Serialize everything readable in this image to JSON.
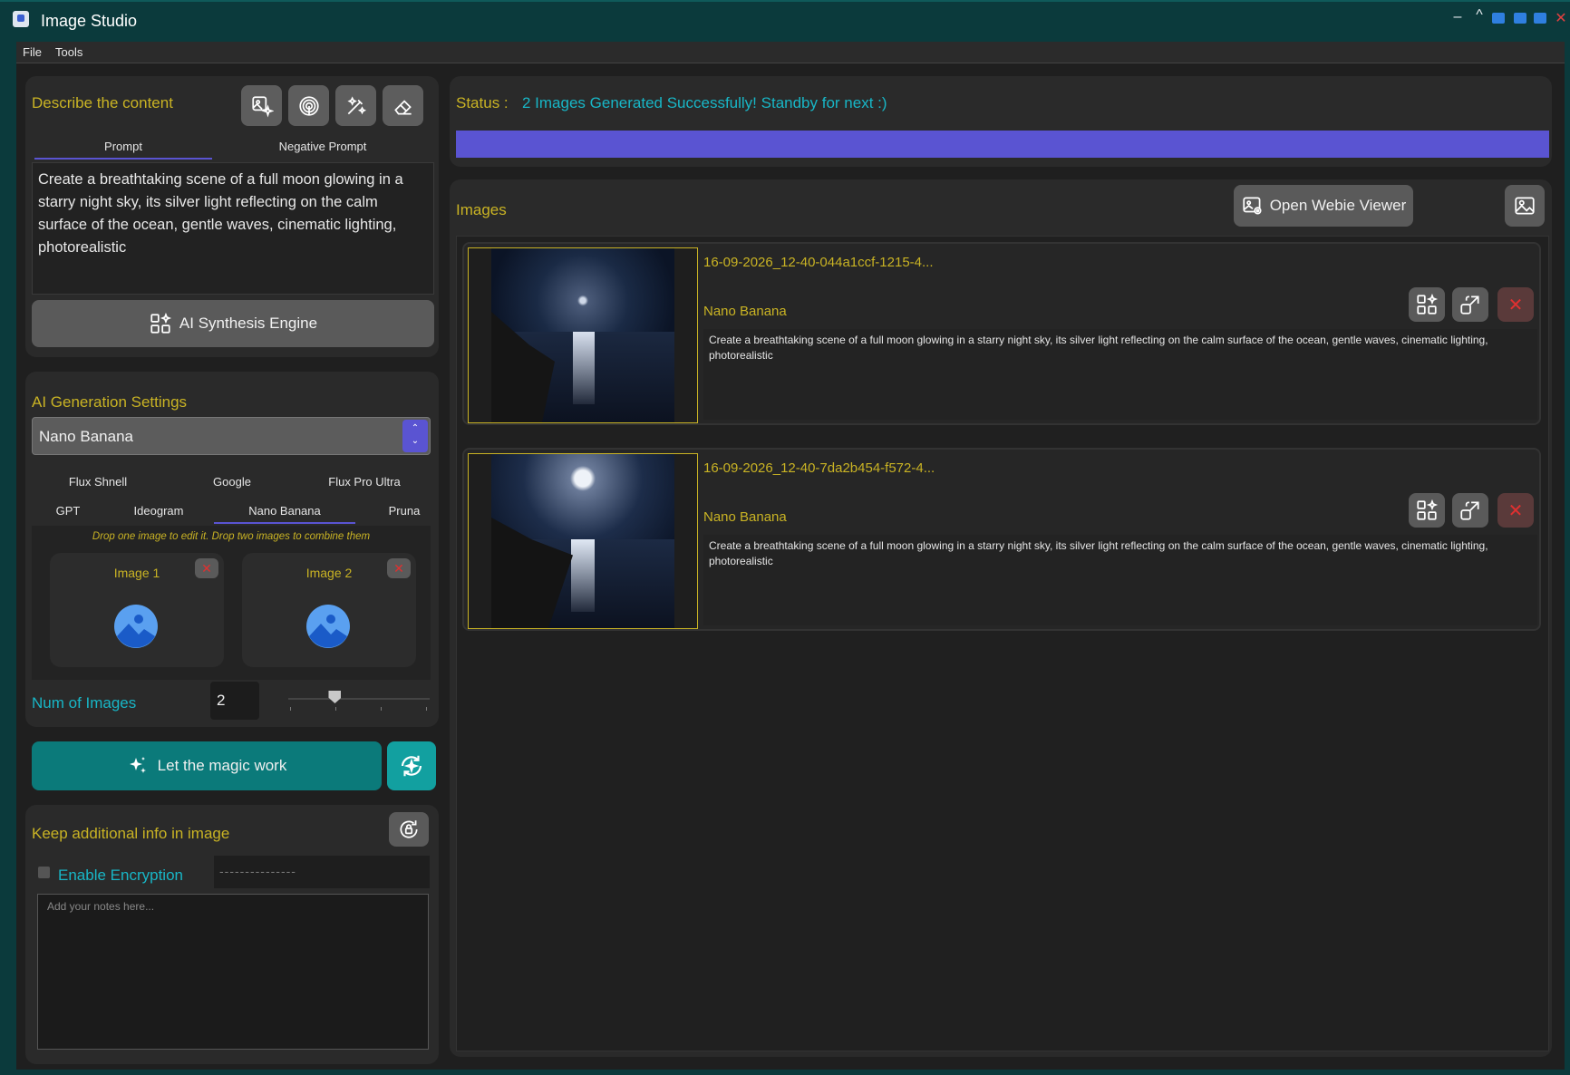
{
  "window": {
    "title": "Image Studio"
  },
  "menu": {
    "file": "File",
    "tools": "Tools"
  },
  "prompt_panel": {
    "heading": "Describe the content",
    "tabs": [
      "Prompt",
      "Negative Prompt"
    ],
    "prompt_text": "Create a breathtaking scene of a full moon glowing in a starry night sky, its silver light reflecting on the calm surface of the ocean, gentle waves, cinematic lighting, photorealistic",
    "engine_button": "AI Synthesis Engine"
  },
  "settings": {
    "heading": "AI Generation Settings",
    "model_selected": "Nano Banana",
    "model_tabs_row1": [
      "Flux Shnell",
      "Google",
      "Flux Pro Ultra"
    ],
    "model_tabs_row2": [
      "GPT",
      "Ideogram",
      "Nano Banana",
      "Pruna"
    ],
    "drop_hint": "Drop one image to edit it. Drop two images to combine them",
    "image1_label": "Image 1",
    "image2_label": "Image 2",
    "num_images_label": "Num of Images",
    "num_images_value": "2",
    "num_images_slider_fraction": 0.33
  },
  "magic_button": "Let the magic work",
  "notes": {
    "heading": "Keep additional info in image",
    "encryption_label": "Enable Encryption",
    "password_mask": "---------------",
    "notes_placeholder": "Add your notes here..."
  },
  "status": {
    "label": "Status :",
    "text": "2 Images Generated Successfully! Standby for next :)",
    "progress_fraction": 1.0,
    "progress_color": "#5a54d2"
  },
  "images_panel": {
    "heading": "Images",
    "webie_button": "Open Webie Viewer",
    "items": [
      {
        "filename": "16-09-2026_12-40-044a1ccf-1215-4...",
        "model": "Nano Banana",
        "prompt": "Create a breathtaking scene of a full moon glowing in a starry night sky, its silver light reflecting on the calm surface of the ocean, gentle waves, cinematic lighting, photorealistic"
      },
      {
        "filename": "16-09-2026_12-40-7da2b454-f572-4...",
        "model": "Nano Banana",
        "prompt": "Create a breathtaking scene of a full moon glowing in a starry night sky, its silver light reflecting on the calm surface of the ocean, gentle waves, cinematic lighting, photorealistic"
      }
    ]
  },
  "colors": {
    "accent_gold": "#c9b324",
    "accent_teal": "#18b6c6",
    "magic_button": "#0b7a7a",
    "progress": "#5a54d2"
  }
}
